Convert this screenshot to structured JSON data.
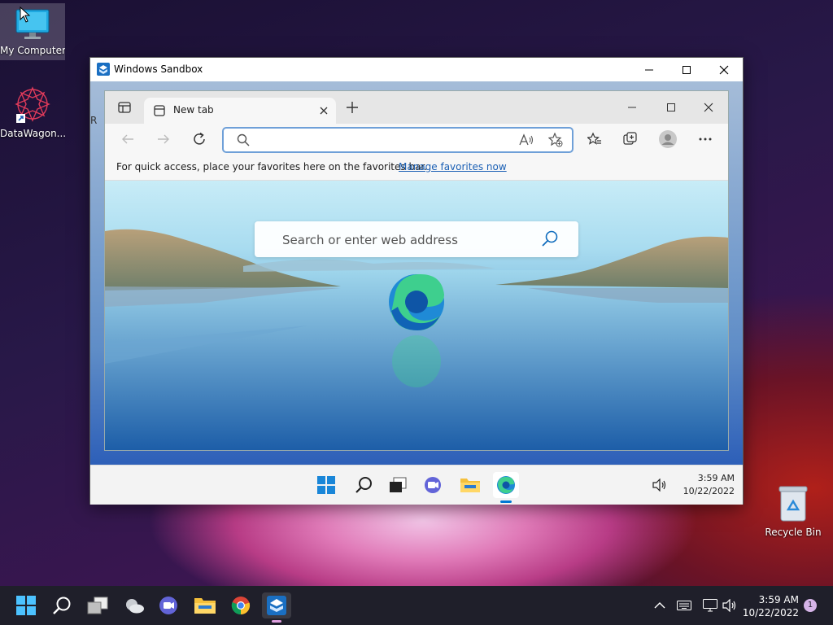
{
  "desktop": {
    "icons": [
      {
        "label": "My Computer"
      },
      {
        "label": "DataWagon..."
      },
      {
        "label": "Recycle Bin"
      }
    ]
  },
  "sandbox": {
    "title": "Windows Sandbox",
    "taskbar": {
      "time": "3:59 AM",
      "date": "10/22/2022"
    }
  },
  "edge": {
    "tab_label": "New tab",
    "address_value": "",
    "favbar_text": "For quick access, place your favorites here on the favorites bar.",
    "favbar_link": "Manage favorites now",
    "ntp_search_placeholder": "Search or enter web address"
  },
  "taskbar": {
    "time": "3:59 AM",
    "date": "10/22/2022",
    "notification_count": "1"
  },
  "colors": {
    "accent": "#0078d4",
    "link": "#1a5fb4",
    "taskbar_bg": "#1f1f2a"
  }
}
